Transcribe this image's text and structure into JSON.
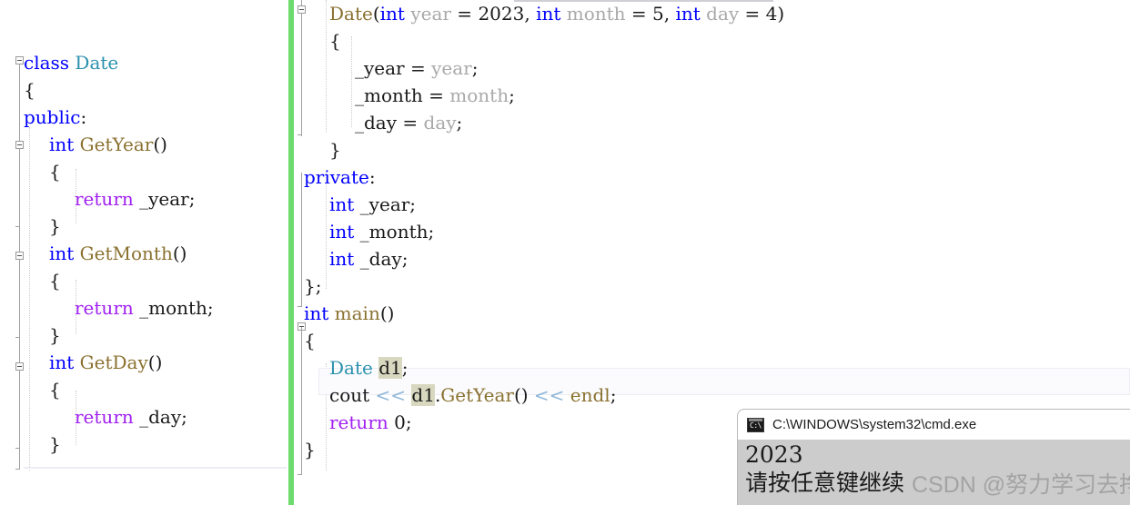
{
  "editor": {
    "left_pane": {
      "name": "code-editor-left",
      "lines": [
        {
          "indent": 0,
          "tokens": [
            {
              "t": "class ",
              "c": "kw"
            },
            {
              "t": "Date",
              "c": "type"
            }
          ]
        },
        {
          "indent": 0,
          "tokens": [
            {
              "t": "{",
              "c": "plain"
            }
          ]
        },
        {
          "indent": 0,
          "tokens": [
            {
              "t": "public",
              "c": "kw"
            },
            {
              "t": ":",
              "c": "plain"
            }
          ]
        },
        {
          "indent": 1,
          "tokens": [
            {
              "t": "int ",
              "c": "kw"
            },
            {
              "t": "GetYear",
              "c": "fn"
            },
            {
              "t": "()",
              "c": "plain"
            }
          ]
        },
        {
          "indent": 1,
          "tokens": [
            {
              "t": "{",
              "c": "plain"
            }
          ]
        },
        {
          "indent": 2,
          "tokens": [
            {
              "t": "return",
              "c": "kw2"
            },
            {
              "t": " _year;",
              "c": "plain"
            }
          ]
        },
        {
          "indent": 1,
          "tokens": [
            {
              "t": "}",
              "c": "plain"
            }
          ]
        },
        {
          "indent": 1,
          "tokens": [
            {
              "t": "int ",
              "c": "kw"
            },
            {
              "t": "GetMonth",
              "c": "fn"
            },
            {
              "t": "()",
              "c": "plain"
            }
          ]
        },
        {
          "indent": 1,
          "tokens": [
            {
              "t": "{",
              "c": "plain"
            }
          ]
        },
        {
          "indent": 2,
          "tokens": [
            {
              "t": "return",
              "c": "kw2"
            },
            {
              "t": " _month;",
              "c": "plain"
            }
          ]
        },
        {
          "indent": 1,
          "tokens": [
            {
              "t": "}",
              "c": "plain"
            }
          ]
        },
        {
          "indent": 1,
          "tokens": [
            {
              "t": "int ",
              "c": "kw"
            },
            {
              "t": "GetDay",
              "c": "fn"
            },
            {
              "t": "()",
              "c": "plain"
            }
          ]
        },
        {
          "indent": 1,
          "tokens": [
            {
              "t": "{",
              "c": "plain"
            }
          ]
        },
        {
          "indent": 2,
          "tokens": [
            {
              "t": "return",
              "c": "kw2"
            },
            {
              "t": " _day;",
              "c": "plain"
            }
          ]
        },
        {
          "indent": 1,
          "tokens": [
            {
              "t": "}",
              "c": "plain"
            }
          ]
        }
      ]
    },
    "right_pane": {
      "name": "code-editor-right",
      "lines": [
        {
          "indent": 1,
          "tokens": [
            {
              "t": "Date",
              "c": "fn"
            },
            {
              "t": "(",
              "c": "plain"
            },
            {
              "t": "int ",
              "c": "kw"
            },
            {
              "t": "year",
              "c": "param"
            },
            {
              "t": " = ",
              "c": "plain"
            },
            {
              "t": "2023",
              "c": "num"
            },
            {
              "t": ", ",
              "c": "plain"
            },
            {
              "t": "int ",
              "c": "kw"
            },
            {
              "t": "month",
              "c": "param"
            },
            {
              "t": " = ",
              "c": "plain"
            },
            {
              "t": "5",
              "c": "num"
            },
            {
              "t": ", ",
              "c": "plain"
            },
            {
              "t": "int ",
              "c": "kw"
            },
            {
              "t": "day",
              "c": "param"
            },
            {
              "t": " = ",
              "c": "plain"
            },
            {
              "t": "4",
              "c": "num"
            },
            {
              "t": ")",
              "c": "plain"
            }
          ]
        },
        {
          "indent": 1,
          "tokens": [
            {
              "t": "{",
              "c": "plain"
            }
          ]
        },
        {
          "indent": 2,
          "tokens": [
            {
              "t": "_year",
              "c": "plain"
            },
            {
              "t": " = ",
              "c": "plain"
            },
            {
              "t": "year",
              "c": "param"
            },
            {
              "t": ";",
              "c": "plain"
            }
          ]
        },
        {
          "indent": 2,
          "tokens": [
            {
              "t": "_month",
              "c": "plain"
            },
            {
              "t": " = ",
              "c": "plain"
            },
            {
              "t": "month",
              "c": "param"
            },
            {
              "t": ";",
              "c": "plain"
            }
          ]
        },
        {
          "indent": 2,
          "tokens": [
            {
              "t": "_day",
              "c": "plain"
            },
            {
              "t": " = ",
              "c": "plain"
            },
            {
              "t": "day",
              "c": "param"
            },
            {
              "t": ";",
              "c": "plain"
            }
          ]
        },
        {
          "indent": 1,
          "tokens": [
            {
              "t": "}",
              "c": "plain"
            }
          ]
        },
        {
          "indent": 0,
          "tokens": [
            {
              "t": "private",
              "c": "kw"
            },
            {
              "t": ":",
              "c": "plain"
            }
          ]
        },
        {
          "indent": 1,
          "tokens": [
            {
              "t": "int",
              "c": "kw"
            },
            {
              "t": " _year;",
              "c": "plain"
            }
          ]
        },
        {
          "indent": 1,
          "tokens": [
            {
              "t": "int",
              "c": "kw"
            },
            {
              "t": " _month;",
              "c": "plain"
            }
          ]
        },
        {
          "indent": 1,
          "tokens": [
            {
              "t": "int",
              "c": "kw"
            },
            {
              "t": " _day;",
              "c": "plain"
            }
          ]
        },
        {
          "indent": 0,
          "tokens": [
            {
              "t": "};",
              "c": "plain"
            }
          ]
        },
        {
          "indent": 0,
          "tokens": [
            {
              "t": "int ",
              "c": "kw"
            },
            {
              "t": "main",
              "c": "fn"
            },
            {
              "t": "()",
              "c": "plain"
            }
          ]
        },
        {
          "indent": 0,
          "tokens": [
            {
              "t": "{",
              "c": "plain"
            }
          ]
        },
        {
          "indent": 1,
          "tokens": [
            {
              "t": "Date",
              "c": "type"
            },
            {
              "t": " ",
              "c": "plain"
            },
            {
              "t": "d1",
              "c": "hl"
            },
            {
              "t": ";",
              "c": "plain"
            }
          ]
        },
        {
          "indent": 1,
          "tokens": [
            {
              "t": "cout",
              "c": "plain"
            },
            {
              "t": " ",
              "c": "plain"
            },
            {
              "t": "<<",
              "c": "op"
            },
            {
              "t": " ",
              "c": "plain"
            },
            {
              "t": "d1",
              "c": "hl"
            },
            {
              "t": ".",
              "c": "plain"
            },
            {
              "t": "GetYear",
              "c": "fn"
            },
            {
              "t": "()",
              "c": "plain"
            },
            {
              "t": " ",
              "c": "plain"
            },
            {
              "t": "<<",
              "c": "op"
            },
            {
              "t": " ",
              "c": "plain"
            },
            {
              "t": "endl",
              "c": "fn"
            },
            {
              "t": ";",
              "c": "plain"
            }
          ]
        },
        {
          "indent": 1,
          "tokens": [
            {
              "t": "return",
              "c": "kw2"
            },
            {
              "t": " 0;",
              "c": "plain"
            }
          ]
        },
        {
          "indent": 0,
          "tokens": [
            {
              "t": "}",
              "c": "plain"
            }
          ]
        }
      ]
    },
    "colors": {
      "keyword": "#0000ff",
      "return_keyword": "#a020f0",
      "type_name": "#2b91af",
      "function_name": "#8a7130",
      "parameter": "#a9a9a9",
      "stream_operator": "#8fb6d9",
      "reference_highlight": "#d7d8bf",
      "change_bar_saved": "#6ddb6d",
      "background": "#ffffff"
    }
  },
  "console": {
    "title": "C:\\WINDOWS\\system32\\cmd.exe",
    "icon": "console-window-icon",
    "icon_prompt_text": "C:\\",
    "output_lines": [
      "2023",
      "请按任意键继续"
    ],
    "background": "#cccccc",
    "titlebar_background": "#ffffff"
  },
  "watermark": {
    "text": "CSDN @努力学习去挣钱",
    "color": "#9b9b9b"
  }
}
